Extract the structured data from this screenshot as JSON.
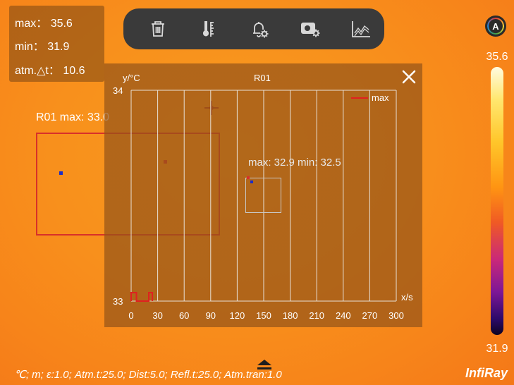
{
  "stats": {
    "max_label": "max：",
    "max_value": "35.6",
    "min_label": "min：",
    "min_value": "31.9",
    "delta_label": "atm.△t：",
    "delta_value": "10.6"
  },
  "toolbar": {
    "items": [
      "trash-icon",
      "thermometer-icon",
      "alarm-bell-settings-icon",
      "camera-settings-icon",
      "trend-chart-icon"
    ]
  },
  "auto_badge": "A",
  "palette": {
    "max": "35.6",
    "min": "31.9",
    "colors": [
      "#fffbe0",
      "#ffe770",
      "#ffc62a",
      "#ff9412",
      "#f05a24",
      "#c9287a",
      "#7d1796",
      "#2c0a6a",
      "#0c0422"
    ]
  },
  "roi_r01": {
    "label": "R01 max: 33.0",
    "color": "#d8302a"
  },
  "roi_box2": {
    "label": "max: 32.9 min: 32.5"
  },
  "chart_panel": {
    "close_icon": "close-icon"
  },
  "chart_data": {
    "type": "line",
    "title": "R01",
    "xlabel": "x/s",
    "ylabel": "y/°C",
    "xlim": [
      0,
      300
    ],
    "ylim": [
      33,
      34
    ],
    "x_ticks": [
      "0",
      "30",
      "60",
      "90",
      "120",
      "150",
      "180",
      "210",
      "240",
      "270",
      "300"
    ],
    "y_ticks": [
      "34",
      "33"
    ],
    "grid": true,
    "legend_position": "top-right",
    "series": [
      {
        "name": "max",
        "color": "#e02020",
        "x": [
          0,
          0,
          6,
          6,
          20,
          20,
          24,
          24
        ],
        "y": [
          33.0,
          33.04,
          33.04,
          33.0,
          33.0,
          33.04,
          33.04,
          33.0
        ]
      }
    ]
  },
  "status_line": "℃; m; ε:1.0; Atm.t:25.0; Dist:5.0; Refl.t:25.0; Atm.tran:1.0",
  "logo": "InfiRay"
}
